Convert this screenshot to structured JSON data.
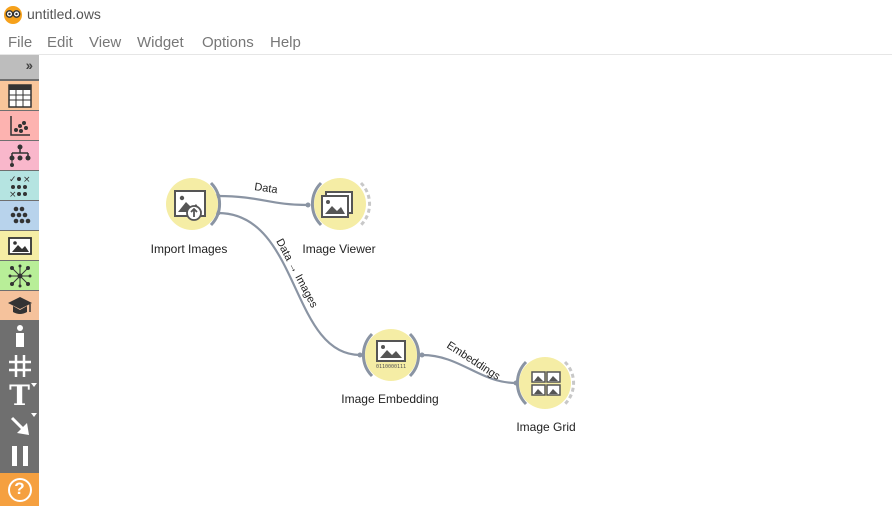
{
  "window": {
    "title": "untitled.ows"
  },
  "menu": {
    "items": [
      "File",
      "Edit",
      "View",
      "Widget",
      "Options",
      "Help"
    ]
  },
  "toolbox": {
    "expand_glyph": "››",
    "categories": [
      {
        "icon": "table-icon",
        "color": "#f9c69b"
      },
      {
        "icon": "scatter-plot-icon",
        "color": "#fdb3b0"
      },
      {
        "icon": "tree-icon",
        "color": "#f9b7cb"
      },
      {
        "icon": "evaluate-icon",
        "color": "#b5e4e1"
      },
      {
        "icon": "cluster-icon",
        "color": "#b8d3ec"
      },
      {
        "icon": "image-analytics-icon",
        "color": "#f5eda5"
      },
      {
        "icon": "network-icon",
        "color": "#b8ee98"
      },
      {
        "icon": "education-icon",
        "color": "#f5c29c"
      }
    ],
    "tools": [
      {
        "icon": "info-icon"
      },
      {
        "icon": "grid-icon"
      },
      {
        "icon": "text-annotation-icon",
        "glyph": "T"
      },
      {
        "icon": "arrow-annotation-icon"
      },
      {
        "icon": "pause-icon"
      },
      {
        "icon": "help-icon",
        "glyph": "?"
      }
    ]
  },
  "workflow": {
    "nodes": [
      {
        "label": "Import Images",
        "icon": "import-images-icon"
      },
      {
        "label": "Image Viewer",
        "icon": "image-viewer-icon"
      },
      {
        "label": "Image Embedding",
        "icon": "image-embedding-icon",
        "icon_text": "0110000111"
      },
      {
        "label": "Image Grid",
        "icon": "image-grid-icon"
      }
    ],
    "links": [
      {
        "label": "Data"
      },
      {
        "label": "Data → Images"
      },
      {
        "label": "Embeddings"
      }
    ]
  },
  "colors": {
    "node_fill": "#f5eda5",
    "node_ring": "#8a94a3",
    "link": "#8a94a3",
    "toolbox_bg": "#6f6f6f",
    "help_button": "#f5a040"
  }
}
